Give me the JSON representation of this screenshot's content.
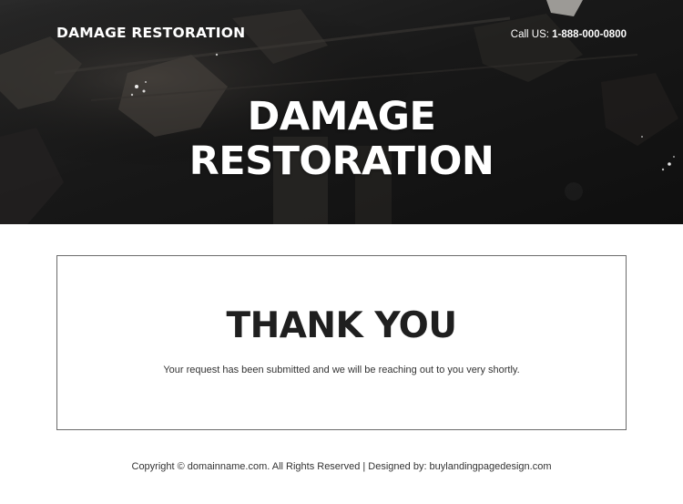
{
  "colors": {
    "hero_background": "#161616",
    "text_light": "#ffffff",
    "heading_dark": "#1f1f1f",
    "body_text": "#333333",
    "box_border": "#6b6b6b"
  },
  "header": {
    "brand": "DAMAGE RESTORATION",
    "call_label": "Call US: ",
    "call_number": "1-888-000-0800"
  },
  "hero": {
    "title_line1": "DAMAGE",
    "title_line2": "RESTORATION"
  },
  "thank_you": {
    "title": "THANK YOU",
    "message": "Your request has been submitted and we will be reaching out to you very shortly."
  },
  "footer": {
    "copyright": "Copyright © domainname.com. All Rights Reserved | Designed by: buylandingpagedesign.com"
  }
}
